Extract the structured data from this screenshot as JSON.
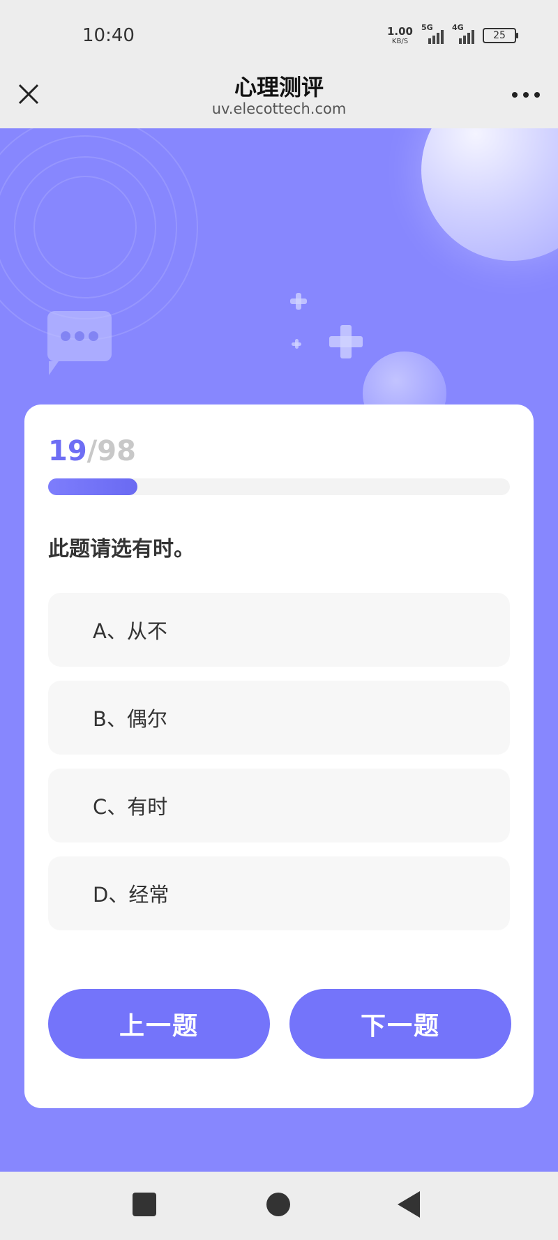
{
  "status_bar": {
    "time": "10:40",
    "net_speed_value": "1.00",
    "net_speed_unit": "KB/S",
    "signal1_label": "5G",
    "signal2_label": "4G",
    "battery": "25"
  },
  "nav": {
    "title": "心理测评",
    "url": "uv.elecottech.com",
    "close_icon": "close-icon",
    "more_icon": "more-icon"
  },
  "quiz": {
    "current": "19",
    "separator": "/",
    "total": "98",
    "progress_fraction": 0.194,
    "question": "此题请选有时。",
    "options": [
      {
        "label": "A、从不"
      },
      {
        "label": "B、偶尔"
      },
      {
        "label": "C、有时"
      },
      {
        "label": "D、经常"
      }
    ],
    "prev_label": "上一题",
    "next_label": "下一题"
  },
  "colors": {
    "accent": "#7474fa",
    "background": "#8787fe"
  }
}
